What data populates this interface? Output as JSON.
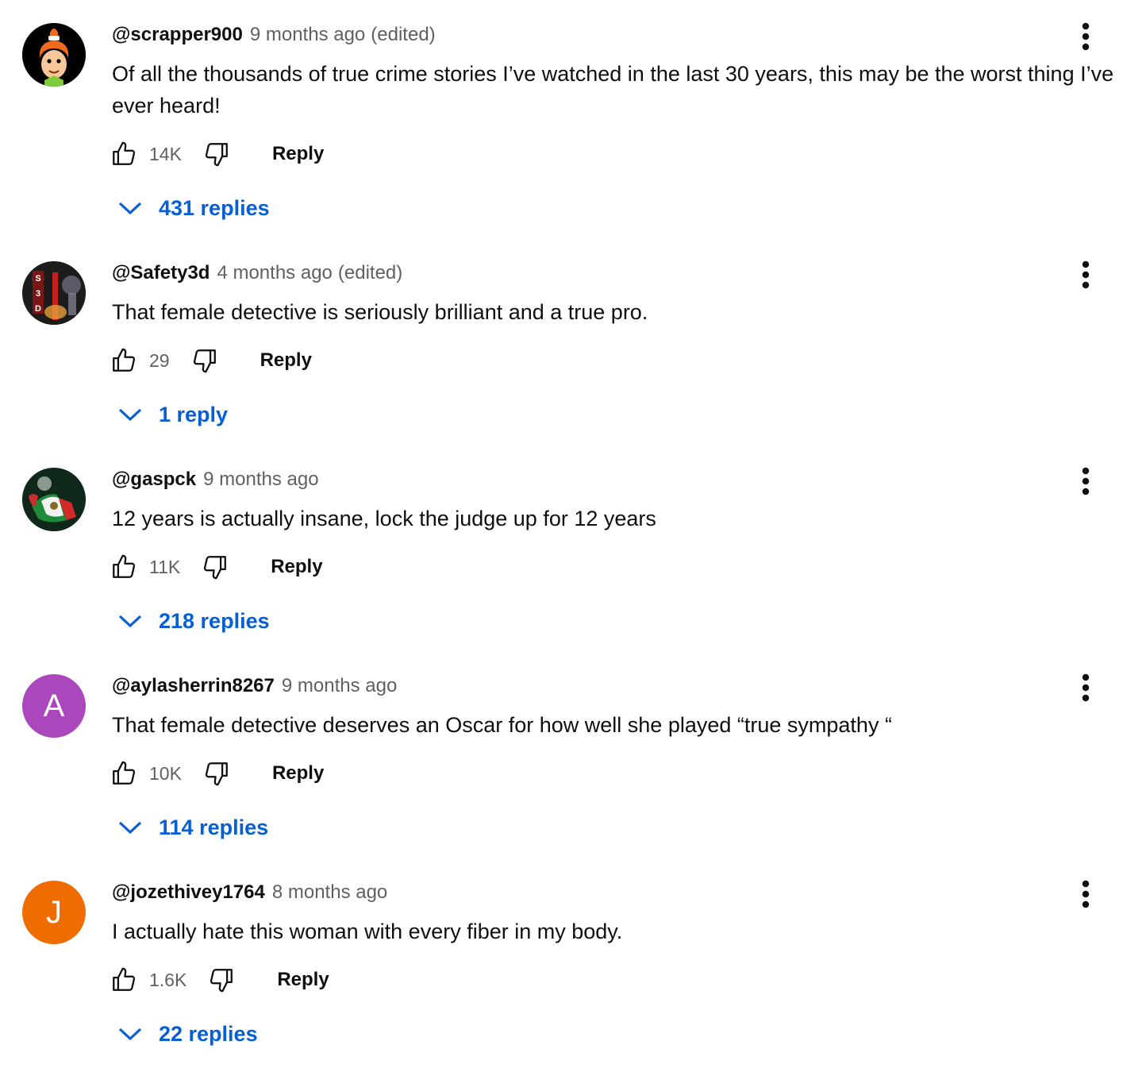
{
  "comments": [
    {
      "author": "@scrapper900",
      "time": "9 months ago",
      "edited": "(edited)",
      "text": "Of all the thousands of true crime stories I’ve watched in the last 30 years, this may be the worst thing I’ve ever heard!",
      "likes": "14K",
      "reply_label": "Reply",
      "replies_label": "431 replies",
      "avatar": {
        "type": "image",
        "icon": "cartoon-girl-icon",
        "bg": "#000000"
      }
    },
    {
      "author": "@Safety3d",
      "time": "4 months ago",
      "edited": "(edited)",
      "text": "That female detective is seriously brilliant and a true pro.",
      "likes": "29",
      "reply_label": "Reply",
      "replies_label": "1 reply",
      "avatar": {
        "type": "image",
        "icon": "night-scene-icon",
        "bg": "#1a1a1a"
      }
    },
    {
      "author": "@gaspck",
      "time": "9 months ago",
      "edited": "",
      "text": "12 years is actually insane, lock the judge up for 12 years",
      "likes": "11K",
      "reply_label": "Reply",
      "replies_label": "218 replies",
      "avatar": {
        "type": "image",
        "icon": "flag-icon",
        "bg": "#14301c"
      }
    },
    {
      "author": "@aylasherrin8267",
      "time": "9 months ago",
      "edited": "",
      "text": "That female detective deserves an Oscar for how well she played “true sympathy “",
      "likes": "10K",
      "reply_label": "Reply",
      "replies_label": "114 replies",
      "avatar": {
        "type": "letter",
        "letter": "A",
        "bg": "#ab47bc"
      }
    },
    {
      "author": "@jozethivey1764",
      "time": "8 months ago",
      "edited": "",
      "text": "I actually hate this woman with every fiber in my body.",
      "likes": "1.6K",
      "reply_label": "Reply",
      "replies_label": "22 replies",
      "avatar": {
        "type": "letter",
        "letter": "J",
        "bg": "#ef6c00"
      }
    }
  ],
  "colors": {
    "link_blue": "#065fd4",
    "meta_gray": "#606060",
    "text": "#0f0f0f"
  }
}
